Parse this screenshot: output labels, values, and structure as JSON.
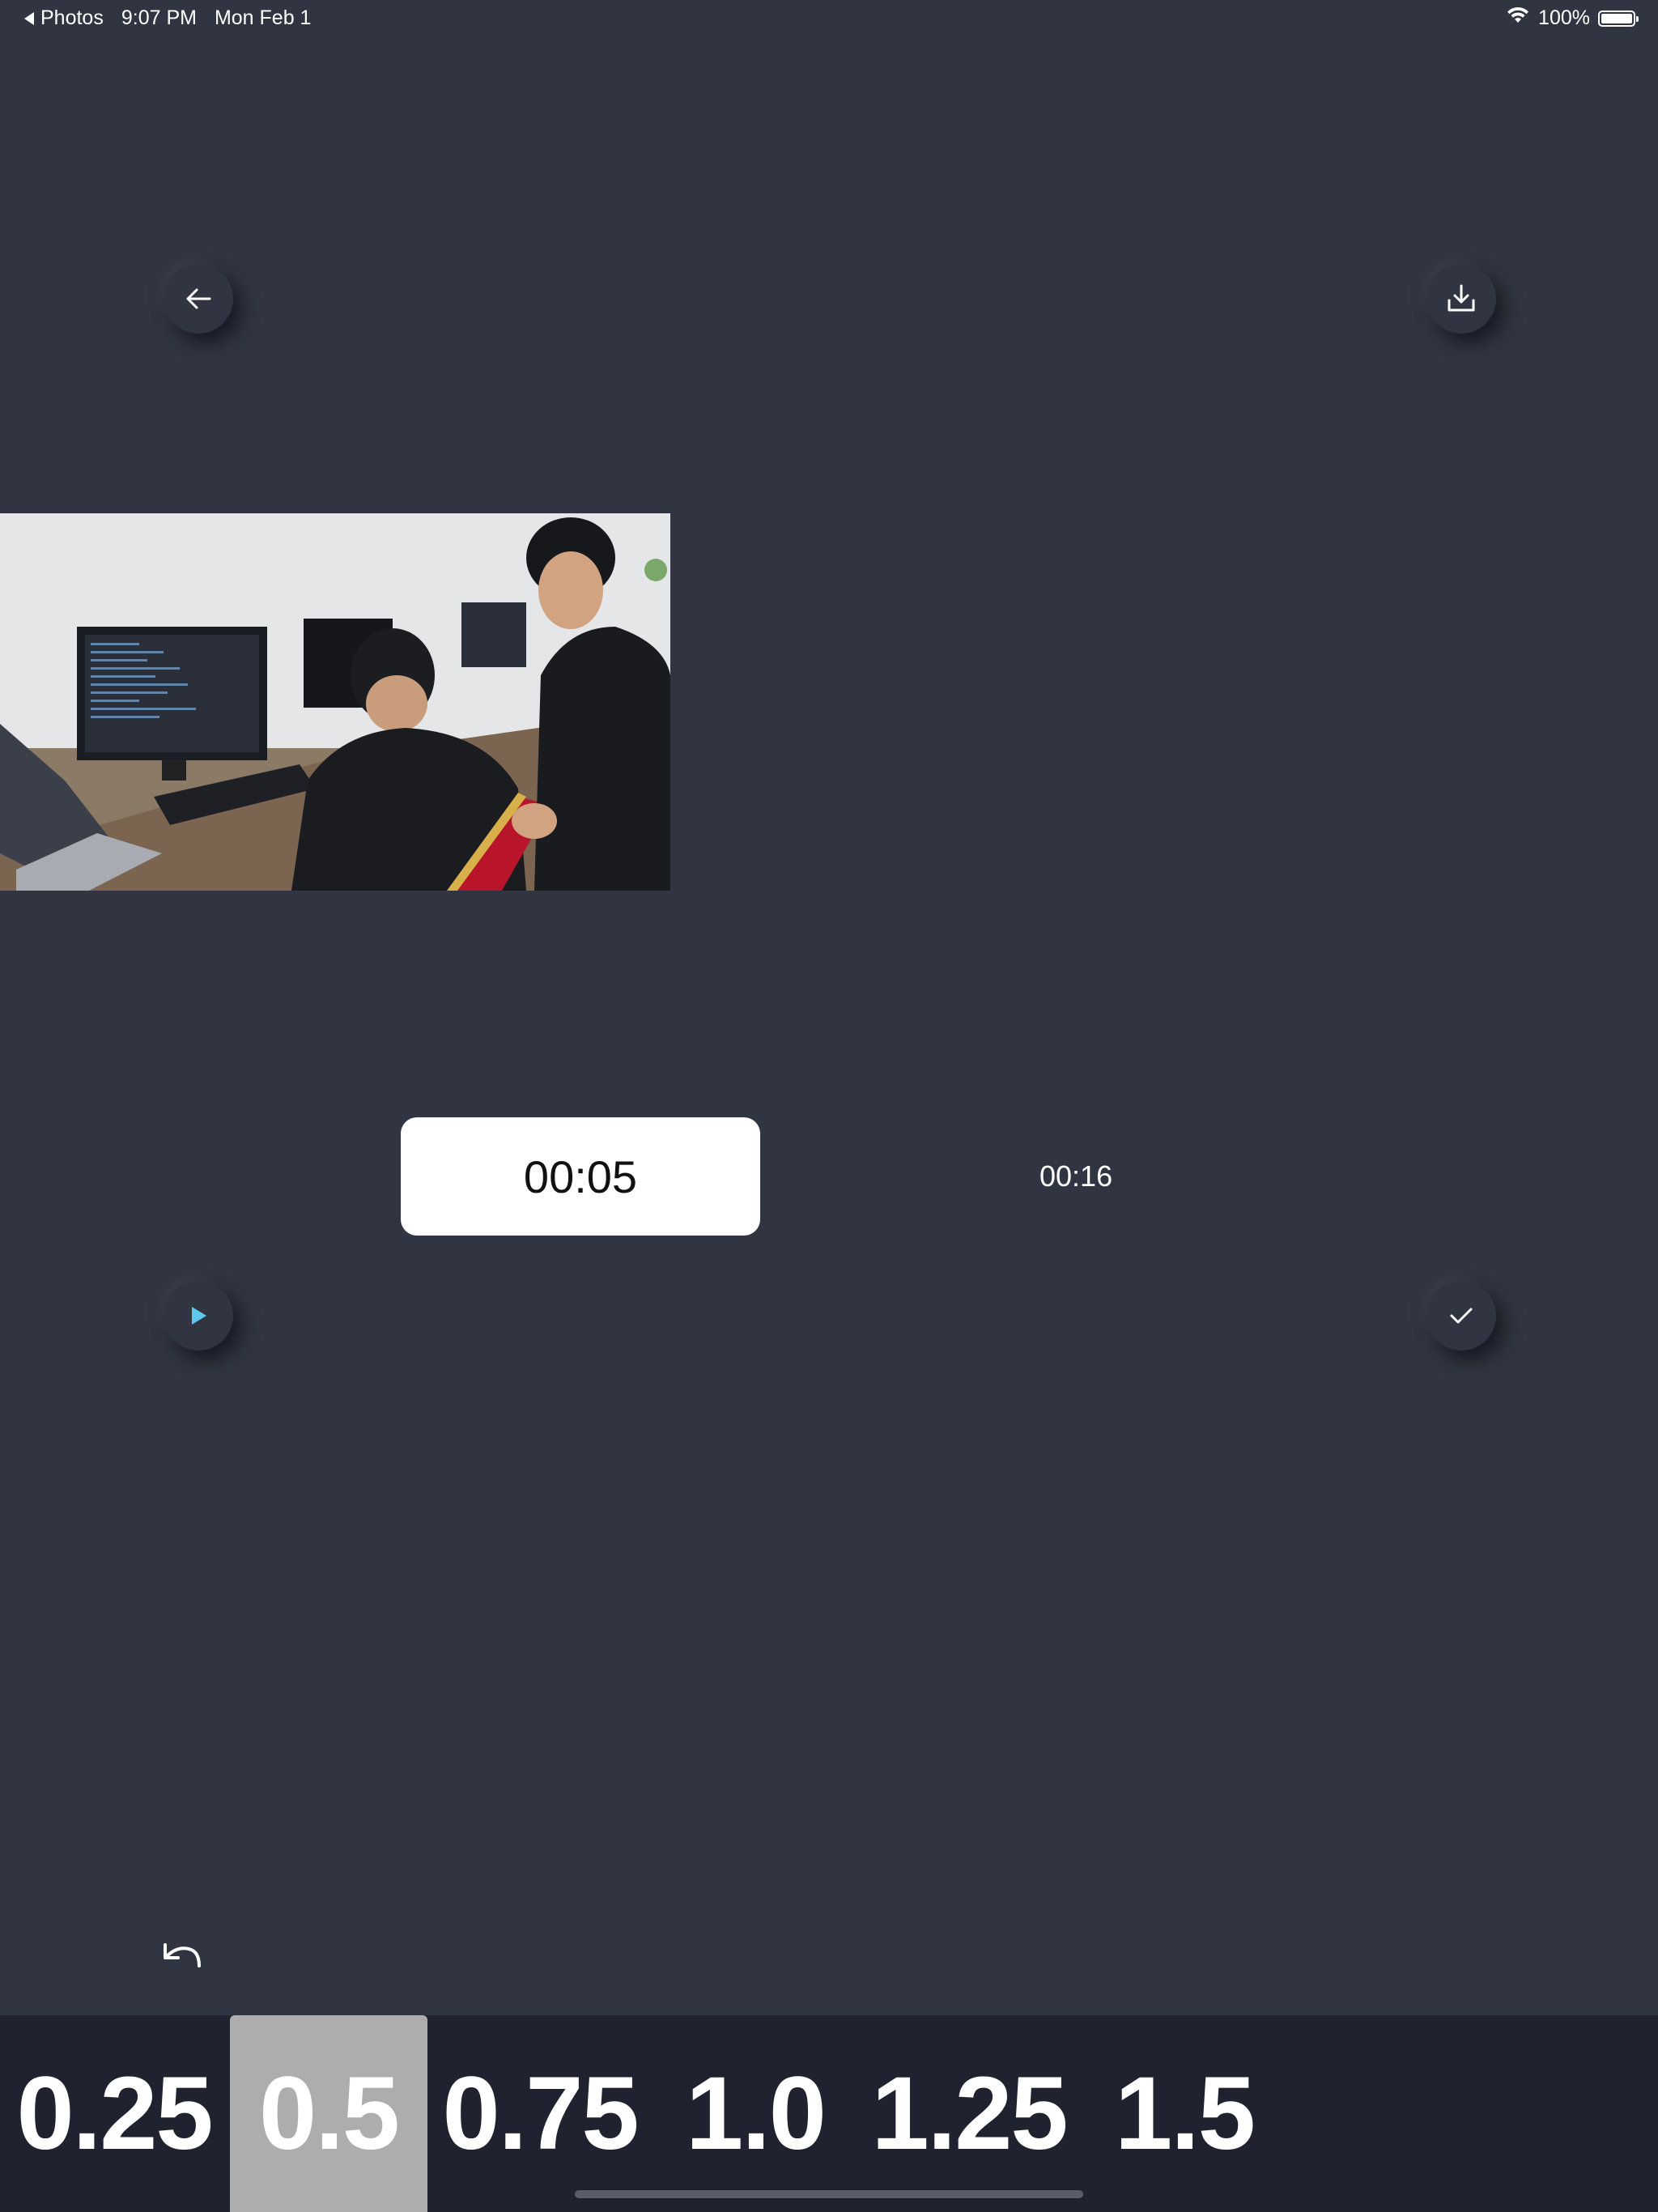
{
  "status_bar": {
    "back_app": "Photos",
    "time": "9:07 PM",
    "date": "Mon Feb 1",
    "battery": "100%"
  },
  "header": {
    "back_icon": "arrow-left-icon",
    "download_icon": "download-icon"
  },
  "playback": {
    "current_time": "00:05",
    "total_time": "00:16",
    "play_icon": "play-icon",
    "confirm_icon": "checkmark-icon",
    "undo_icon": "undo-icon"
  },
  "speed": {
    "options": [
      "0.25",
      "0.5",
      "0.75",
      "1.0",
      "1.25",
      "1.5"
    ],
    "selected": "0.5"
  },
  "colors": {
    "background": "#313541",
    "speed_bar": "#20232f",
    "selected_speed": "#adadad",
    "play_accent": "#5cc8f0"
  }
}
